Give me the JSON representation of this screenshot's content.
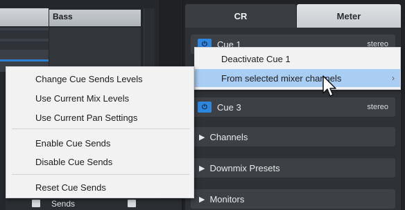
{
  "mixer": {
    "channel_name": "Bass",
    "bottom_label": "Sends"
  },
  "tabs": [
    {
      "label": "CR",
      "active": true
    },
    {
      "label": "Meter",
      "active": false
    }
  ],
  "cues": [
    {
      "label": "Cue 1",
      "format": "stereo"
    },
    {
      "label": "Cue 3",
      "format": "stereo"
    }
  ],
  "sections": [
    {
      "label": "Channels"
    },
    {
      "label": "Downmix Presets"
    },
    {
      "label": "Monitors"
    }
  ],
  "submenu": {
    "items": [
      {
        "label": "Deactivate Cue 1",
        "highlighted": false
      },
      {
        "label": "From selected mixer channels",
        "highlighted": true,
        "has_submenu": true
      }
    ]
  },
  "context_menu": {
    "groups": [
      [
        {
          "label": "Change Cue Sends Levels"
        },
        {
          "label": "Use Current Mix Levels"
        },
        {
          "label": "Use Current Pan Settings"
        }
      ],
      [
        {
          "label": "Enable Cue Sends"
        },
        {
          "label": "Disable Cue Sends"
        }
      ],
      [
        {
          "label": "Reset Cue Sends"
        }
      ]
    ]
  },
  "icons": {
    "power": "power-icon",
    "expand": "triangle-right-icon",
    "submenu_arrow": "chevron-right-icon",
    "cursor": "arrow-cursor-icon"
  },
  "colors": {
    "accent_blue": "#2d86e0",
    "highlight": "#a9cdf3",
    "menu_bg": "#f2f2f2",
    "panel_bg": "#2e3135"
  }
}
